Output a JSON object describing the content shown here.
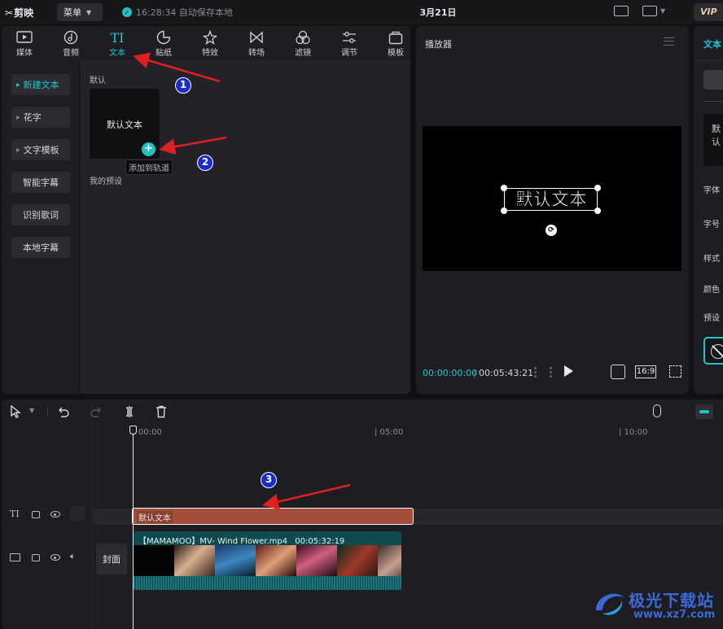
{
  "titlebar": {
    "logo_text": "剪映",
    "menu_label": "菜单",
    "autosave": "16:28:34 自动保存本地",
    "project_title": "3月21日",
    "vip": "VIP"
  },
  "toolbar": {
    "tabs": [
      {
        "label": "媒体",
        "icon": "media-icon"
      },
      {
        "label": "音频",
        "icon": "audio-icon"
      },
      {
        "label": "文本",
        "icon": "text-icon",
        "active": true
      },
      {
        "label": "贴纸",
        "icon": "sticker-icon"
      },
      {
        "label": "特效",
        "icon": "effects-icon"
      },
      {
        "label": "转场",
        "icon": "transition-icon"
      },
      {
        "label": "滤镜",
        "icon": "filter-icon"
      },
      {
        "label": "调节",
        "icon": "adjust-icon"
      },
      {
        "label": "模板",
        "icon": "template-icon"
      }
    ]
  },
  "sidebar": {
    "items": [
      {
        "label": "新建文本",
        "active": true,
        "expandable": true
      },
      {
        "label": "花字",
        "expandable": true
      },
      {
        "label": "文字模板",
        "expandable": true
      },
      {
        "label": "智能字幕"
      },
      {
        "label": "识别歌词"
      },
      {
        "label": "本地字幕"
      }
    ]
  },
  "content": {
    "section_default": "默认",
    "card_label": "默认文本",
    "add_tooltip": "添加到轨道",
    "section_preset": "我的预设"
  },
  "player": {
    "title": "播放器",
    "overlay_text": "默认文本",
    "time_current": "00:00:00:00",
    "time_separator": "|",
    "time_total": "00:05:43:21",
    "ratio": "16:9"
  },
  "props": {
    "tab": "文本",
    "preview_text": "默认",
    "labels": [
      "字体",
      "字号",
      "样式",
      "颜色",
      "预设"
    ]
  },
  "timeline": {
    "ticks": [
      "00:00",
      "| 05:00",
      "| 10:00"
    ],
    "text_clip_label": "默认文本",
    "text_track_icon": "TI",
    "cover_label": "封面",
    "video_clip_label": "【MAMAMOO】MV- Wind Flower.mp4",
    "video_clip_duration": "00:05:32:19"
  },
  "annotations": {
    "badges": [
      "1",
      "2",
      "3"
    ]
  },
  "watermark": {
    "text": "极光下载站",
    "url": "www.xz7.com"
  },
  "colors": {
    "accent": "#22c4d4",
    "text_clip": "#a24e3a",
    "video_clip": "#0e4a4e",
    "arrow": "#e02020",
    "badge": "#1c2bd0"
  }
}
